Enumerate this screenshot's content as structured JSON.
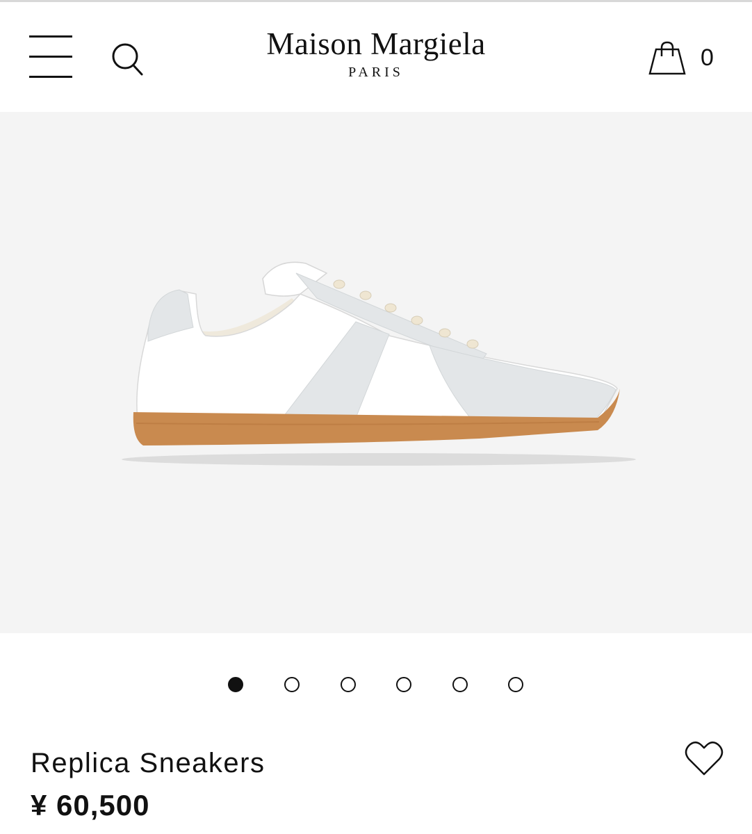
{
  "header": {
    "brand_name": "Maison Margiela",
    "brand_sub": "PARIS",
    "cart_count": "0"
  },
  "icons": {
    "menu": "hamburger-menu-icon",
    "search": "search-icon",
    "cart": "shopping-bag-icon",
    "wishlist": "heart-icon"
  },
  "gallery": {
    "image_count": 6,
    "active_index": 0,
    "background": "#f4f4f4"
  },
  "product": {
    "name": "Replica Sneakers",
    "price": "¥ 60,500"
  },
  "colors": {
    "text": "#111111",
    "sole": "#c98a4f",
    "suede": "#e3e6e8",
    "leather": "#ffffff"
  }
}
